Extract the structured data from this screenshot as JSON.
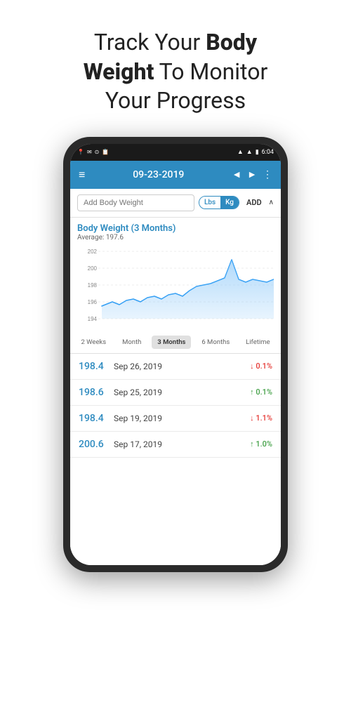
{
  "headline": {
    "line1": "Track Your ",
    "bold1": "Body",
    "line2": "Weight",
    "line3": " To Monitor",
    "line4": "Your Progress"
  },
  "statusBar": {
    "time": "6:04",
    "icons": [
      "location",
      "mail",
      "circle",
      "clipboard",
      "wifi",
      "signal",
      "battery"
    ]
  },
  "appBar": {
    "menu_icon": "≡",
    "date": "09-23-2019",
    "prev_icon": "◄",
    "next_icon": "►",
    "more_icon": "⋮"
  },
  "addWeight": {
    "placeholder": "Add Body Weight",
    "lbs_label": "Lbs",
    "kg_label": "Kg",
    "add_label": "ADD"
  },
  "chart": {
    "title": "Body Weight (3 Months)",
    "avg_label": "Average: 197.6",
    "y_min": 194,
    "y_max": 202,
    "y_labels": [
      "202",
      "200",
      "198",
      "196",
      "194"
    ]
  },
  "timeTabs": [
    {
      "label": "2 Weeks",
      "active": false
    },
    {
      "label": "Month",
      "active": false
    },
    {
      "label": "3 Months",
      "active": true
    },
    {
      "label": "6 Months",
      "active": false
    },
    {
      "label": "Lifetime",
      "active": false
    }
  ],
  "weightEntries": [
    {
      "value": "198.4",
      "date": "Sep 26, 2019",
      "change": "↓ 0.1%",
      "direction": "up"
    },
    {
      "value": "198.6",
      "date": "Sep 25, 2019",
      "change": "↑ 0.1%",
      "direction": "down"
    },
    {
      "value": "198.4",
      "date": "Sep 19, 2019",
      "change": "↓ 1.1%",
      "direction": "up"
    },
    {
      "value": "200.6",
      "date": "Sep 17, 2019",
      "change": "↑ 1.0%",
      "direction": "down"
    }
  ]
}
